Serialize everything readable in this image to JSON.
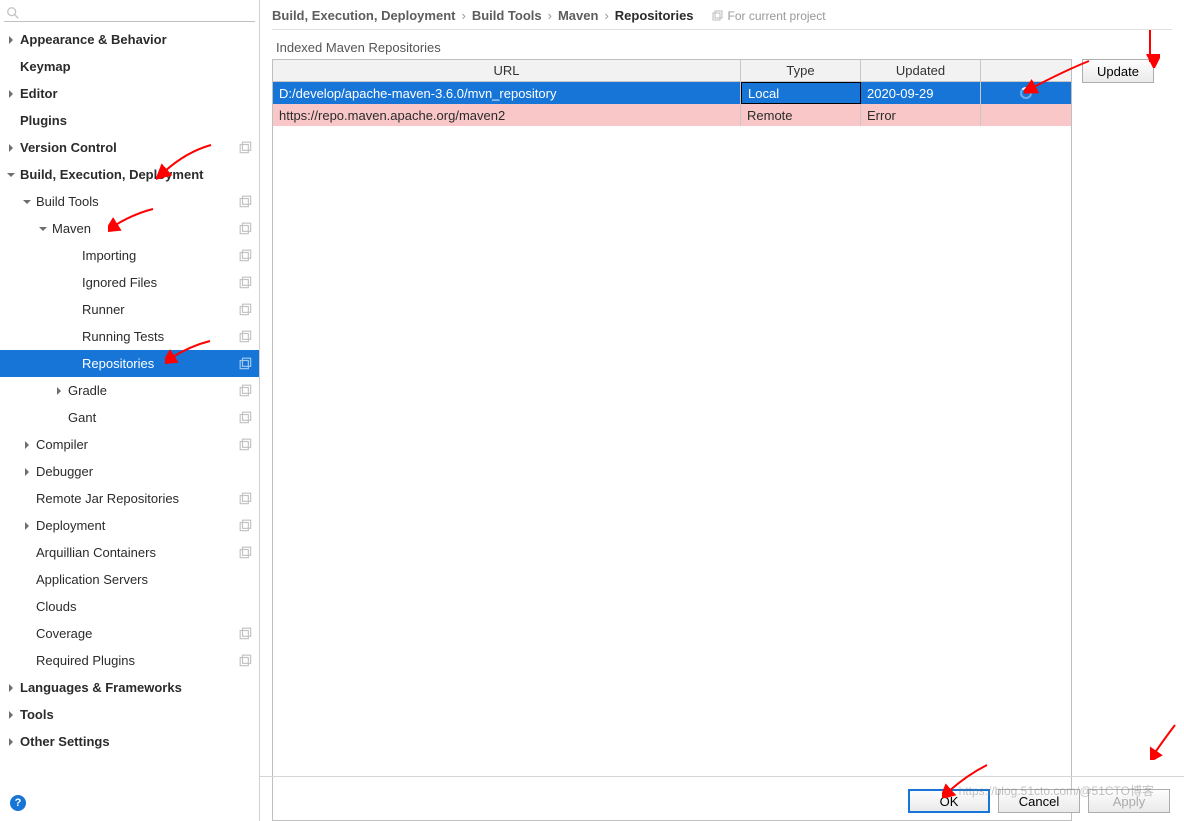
{
  "breadcrumb": {
    "crumb1": "Build, Execution, Deployment",
    "crumb2": "Build Tools",
    "crumb3": "Maven",
    "current": "Repositories",
    "sep": "›",
    "scope": "For current project"
  },
  "sidebar": {
    "search_placeholder": "",
    "items": [
      {
        "label": "Appearance & Behavior",
        "level": 0,
        "bold": true,
        "chev": "right"
      },
      {
        "label": "Keymap",
        "level": 0,
        "bold": true
      },
      {
        "label": "Editor",
        "level": 0,
        "bold": true,
        "chev": "right"
      },
      {
        "label": "Plugins",
        "level": 0,
        "bold": true
      },
      {
        "label": "Version Control",
        "level": 0,
        "bold": true,
        "chev": "right",
        "copy": true
      },
      {
        "label": "Build, Execution, Deployment",
        "level": 0,
        "bold": true,
        "chev": "down"
      },
      {
        "label": "Build Tools",
        "level": 1,
        "chev": "down",
        "copy": true
      },
      {
        "label": "Maven",
        "level": 2,
        "chev": "down",
        "copy": true
      },
      {
        "label": "Importing",
        "level": 3,
        "copy": true
      },
      {
        "label": "Ignored Files",
        "level": 3,
        "copy": true
      },
      {
        "label": "Runner",
        "level": 3,
        "copy": true
      },
      {
        "label": "Running Tests",
        "level": 3,
        "copy": true
      },
      {
        "label": "Repositories",
        "level": 3,
        "copy": true,
        "selected": true
      },
      {
        "label": "Gradle",
        "level": "3b",
        "chev": "right",
        "copy": true
      },
      {
        "label": "Gant",
        "level": "3b",
        "copy": true
      },
      {
        "label": "Compiler",
        "level": 1,
        "chev": "right",
        "copy": true
      },
      {
        "label": "Debugger",
        "level": 1,
        "chev": "right"
      },
      {
        "label": "Remote Jar Repositories",
        "level": 1,
        "copy": true
      },
      {
        "label": "Deployment",
        "level": 1,
        "chev": "right",
        "copy": true
      },
      {
        "label": "Arquillian Containers",
        "level": 1,
        "copy": true
      },
      {
        "label": "Application Servers",
        "level": 1
      },
      {
        "label": "Clouds",
        "level": 1
      },
      {
        "label": "Coverage",
        "level": 1,
        "copy": true
      },
      {
        "label": "Required Plugins",
        "level": 1,
        "copy": true
      },
      {
        "label": "Languages & Frameworks",
        "level": 0,
        "bold": true,
        "chev": "right"
      },
      {
        "label": "Tools",
        "level": 0,
        "bold": true,
        "chev": "right"
      },
      {
        "label": "Other Settings",
        "level": 0,
        "bold": true,
        "chev": "right"
      }
    ]
  },
  "section_label": "Indexed Maven Repositories",
  "table": {
    "headers": {
      "url": "URL",
      "type": "Type",
      "updated": "Updated"
    },
    "rows": [
      {
        "url": "D:/develop/apache-maven-3.6.0/mvn_repository",
        "type": "Local",
        "updated": "2020-09-29",
        "state": "selected",
        "indexing": true
      },
      {
        "url": "https://repo.maven.apache.org/maven2",
        "type": "Remote",
        "updated": "Error",
        "state": "error"
      }
    ]
  },
  "buttons": {
    "update": "Update",
    "ok": "OK",
    "cancel": "Cancel",
    "apply": "Apply"
  },
  "help": "?",
  "watermark": "https://blog.51cto.com/@51CTO博客"
}
